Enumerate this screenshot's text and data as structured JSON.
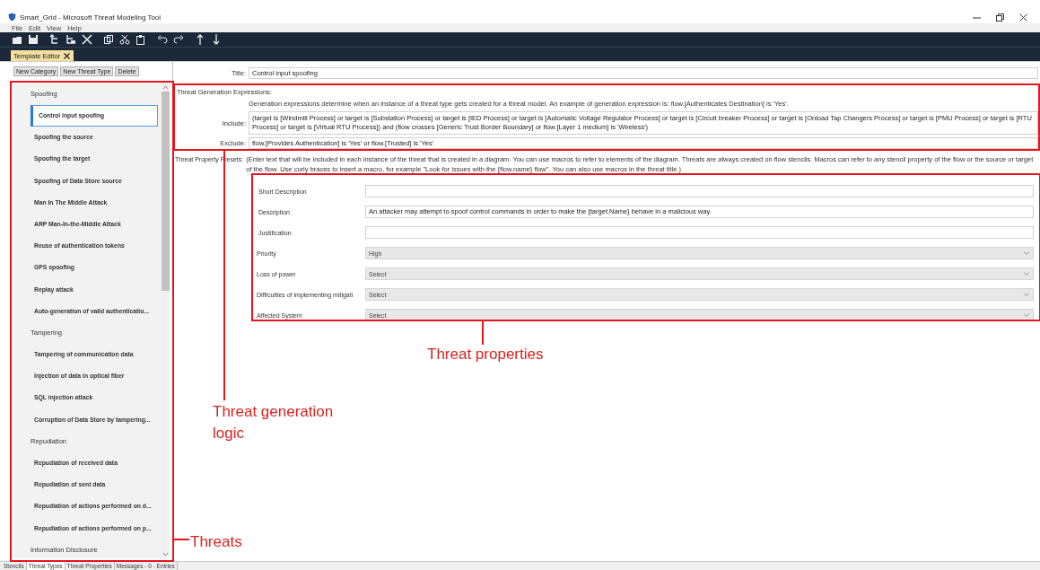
{
  "window": {
    "title": "Smart_Grid - Microsoft Threat Modeling Tool"
  },
  "menu": [
    "File",
    "Edit",
    "View",
    "Help"
  ],
  "document_tabs": [
    {
      "label": "Template Editor",
      "selected": true
    }
  ],
  "left_panel": {
    "buttons": [
      "New Category",
      "New Threat Type",
      "Delete"
    ],
    "threat_tree": [
      {
        "label": "Spoofing",
        "selected": false,
        "children": [
          {
            "label": "Control input spoofing",
            "selected": true
          },
          {
            "label": "Spoofing the source",
            "selected": false
          },
          {
            "label": "Spoofing the target",
            "selected": false
          },
          {
            "label": "Spoofing of Data Store source",
            "selected": false
          },
          {
            "label": "Man In The Middle Attack",
            "selected": false
          },
          {
            "label": "ARP Man-In-the-Middle Attack",
            "selected": false
          },
          {
            "label": "Reuse of authentication tokens",
            "selected": false
          },
          {
            "label": "GPS spoofing",
            "selected": false
          },
          {
            "label": "Replay attack",
            "selected": false
          },
          {
            "label": "Auto-generation of valid authenticatio...",
            "selected": false
          }
        ]
      },
      {
        "label": "Tampering",
        "selected": false,
        "children": [
          {
            "label": "Tampering of communication data",
            "selected": false
          },
          {
            "label": "Injection of data in optical fiber",
            "selected": false
          },
          {
            "label": "SQL injection attack",
            "selected": false
          },
          {
            "label": "Corruption of Data Store by tampering...",
            "selected": false
          }
        ]
      },
      {
        "label": "Repudiation",
        "selected": false,
        "children": [
          {
            "label": "Repudiation of received data",
            "selected": false
          },
          {
            "label": "Repudiation of sent data",
            "selected": false
          },
          {
            "label": "Repudiation of actions performed on d...",
            "selected": false
          },
          {
            "label": "Repudiation of actions performed on p...",
            "selected": false
          }
        ]
      },
      {
        "label": "Information Disclosure",
        "selected": false
      }
    ]
  },
  "editor": {
    "title_label": "Title:",
    "title_value": "Control input spoofing",
    "generation": {
      "heading": "Threat Generation Expressions:",
      "description": "Generation expressions determine when an instance of a threat type gets created for a threat model. An example of generation expression is: flow.[Authenticates Destination] is 'Yes'.",
      "include_label": "Include:",
      "include_value": "(target is [Windmill Process] or target is [Substation Process] or target is [IED Process] or target is [Automatic Voltage Regulator Process] or target is [Circuit breaker Process] or target is [Onload Tap Changers Process] or target is  [PMU Process] or  target is [RTU Process] or target is [Virtual RTU Process]) and (flow crosses  [Generic Trust Border Boundary] or  flow.[Layer 1 medium] is 'Wireless')",
      "exclude_label": "Exclude:",
      "exclude_value": "flow.[Provides Authentication] is 'Yes' or flow.[Trusted] is 'Yes'"
    },
    "presets": {
      "label": "Threat Property Presets:",
      "description": "(Enter text that will be included in each instance of the threat that is created in a diagram. You can use macros to refer to elements of the diagram. Threats are always created on flow stencils. Macros can refer to any stencil property of the flow or the source or target of the flow. Use curly braces to insert a macro, for example \"Look for issues with the {flow.name} flow\". You can also use macros in the threat title.)",
      "properties": [
        {
          "kind": "text",
          "label": "Short Description"
        },
        {
          "kind": "text",
          "label": "Description",
          "value": "An attacker may attempt to spoof control commands in order to make the {target.Name} behave in a malicious way."
        },
        {
          "kind": "text",
          "label": "Justification"
        },
        {
          "kind": "dropdown",
          "label": "Priority",
          "value": "High"
        },
        {
          "kind": "dropdown",
          "label": "Loss of power",
          "value": "Select"
        },
        {
          "kind": "dropdown",
          "label": "Difficulties of implementing mitigati",
          "value": "Select"
        },
        {
          "kind": "dropdown",
          "label": "Affected System",
          "value": "Select"
        }
      ]
    }
  },
  "bottom_tabs": [
    {
      "label": "Stencils",
      "selected": false
    },
    {
      "label": "Threat Types",
      "selected": true
    },
    {
      "label": "Threat Properties",
      "selected": false
    },
    {
      "label": "Messages - 0 - Entries",
      "selected": false
    }
  ],
  "annotations": [
    {
      "kind": "properties",
      "text": "Threat properties"
    },
    {
      "kind": "generation",
      "text": "Threat generation logic"
    },
    {
      "kind": "threats",
      "text": "Threats"
    }
  ]
}
